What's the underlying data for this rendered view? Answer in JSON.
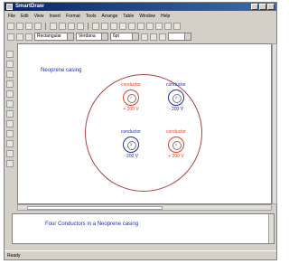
{
  "window": {
    "title": "SmartDraw"
  },
  "menu": [
    "File",
    "Edit",
    "View",
    "Insert",
    "Format",
    "Tools",
    "Arrange",
    "Table",
    "Window",
    "Help"
  ],
  "toolbar2": {
    "style_combo": "Rectangular",
    "font_combo": "Verdana",
    "size_combo": "6pt"
  },
  "diagram": {
    "title": "Neoprene casing",
    "conductors": [
      {
        "label": "conductor",
        "ring": "1",
        "value": "+ 200 V",
        "color": "#e04020"
      },
      {
        "label": "conductor",
        "ring": "2",
        "value": "- 200 V",
        "color": "#203090"
      },
      {
        "label": "conductor",
        "ring": "3",
        "value": "- 200 V",
        "color": "#203090"
      },
      {
        "label": "conductor",
        "ring": "4",
        "value": "+ 200 V",
        "color": "#e04020"
      }
    ]
  },
  "description": {
    "text": "Four Conductors in a Neoprene casing"
  },
  "status": {
    "text": "Ready"
  }
}
